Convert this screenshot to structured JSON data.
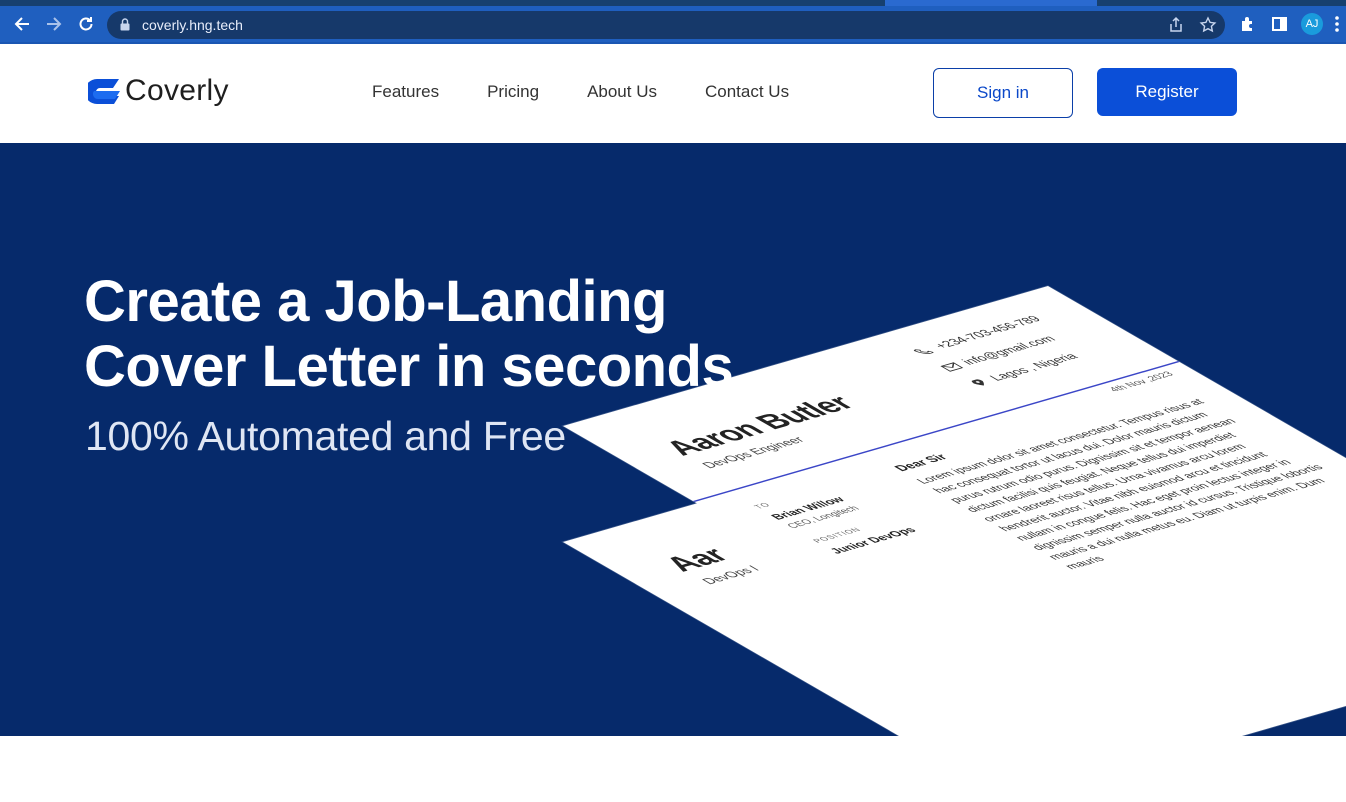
{
  "browser": {
    "url": "coverly.hng.tech",
    "avatar_initials": "AJ",
    "accent": "#1f5fbf"
  },
  "header": {
    "logo_text": "Coverly",
    "nav": [
      "Features",
      "Pricing",
      "About Us",
      "Contact Us"
    ],
    "signin_label": "Sign in",
    "register_label": "Register",
    "brand_color": "#0b4fd8"
  },
  "hero": {
    "title_line1": "Create a Job-Landing",
    "title_line2": "Cover Letter in seconds",
    "subtitle": "100% Automated and Free",
    "background": "#062a6b"
  },
  "letter": {
    "name": "Aaron Butler",
    "role": "DevOps Engineer",
    "phone": "+234-703-456-789",
    "email": "info@gmail.com",
    "location": "Lagos , Nigeria",
    "date": "4th Nov ,2023",
    "to_label": "TO",
    "to_name": "Brian Willow",
    "to_role": "CEO, Longitech",
    "position_label": "POSITION",
    "position_value": "Junior DevOps",
    "greeting": "Dear Sir",
    "body": "Lorem ipsum dolor sit amet consectetur. Tempus risus at hac consequat tortor ut lacus dui. Dolor mauris dictum purus rutrum odio purus. Dignissim sit et tempor aenean dictum facilisi quis feugiat. Neque tellus dui imperdiet ornare laoreet risus tellus. Urna vivamus arcu lorem hendrerit auctor. Vitae nibh euismod arcu et tincidunt nullam in congue felis. Hac eget proin lectus integer in dignissim semper nulla auctor id cursus. Tristique lobortis mauris a dui nulla metus eu. Diam ut turpis enim. Dum mauris"
  },
  "letter_back": {
    "name_partial": "Aar",
    "role_partial": "DevOps I"
  }
}
